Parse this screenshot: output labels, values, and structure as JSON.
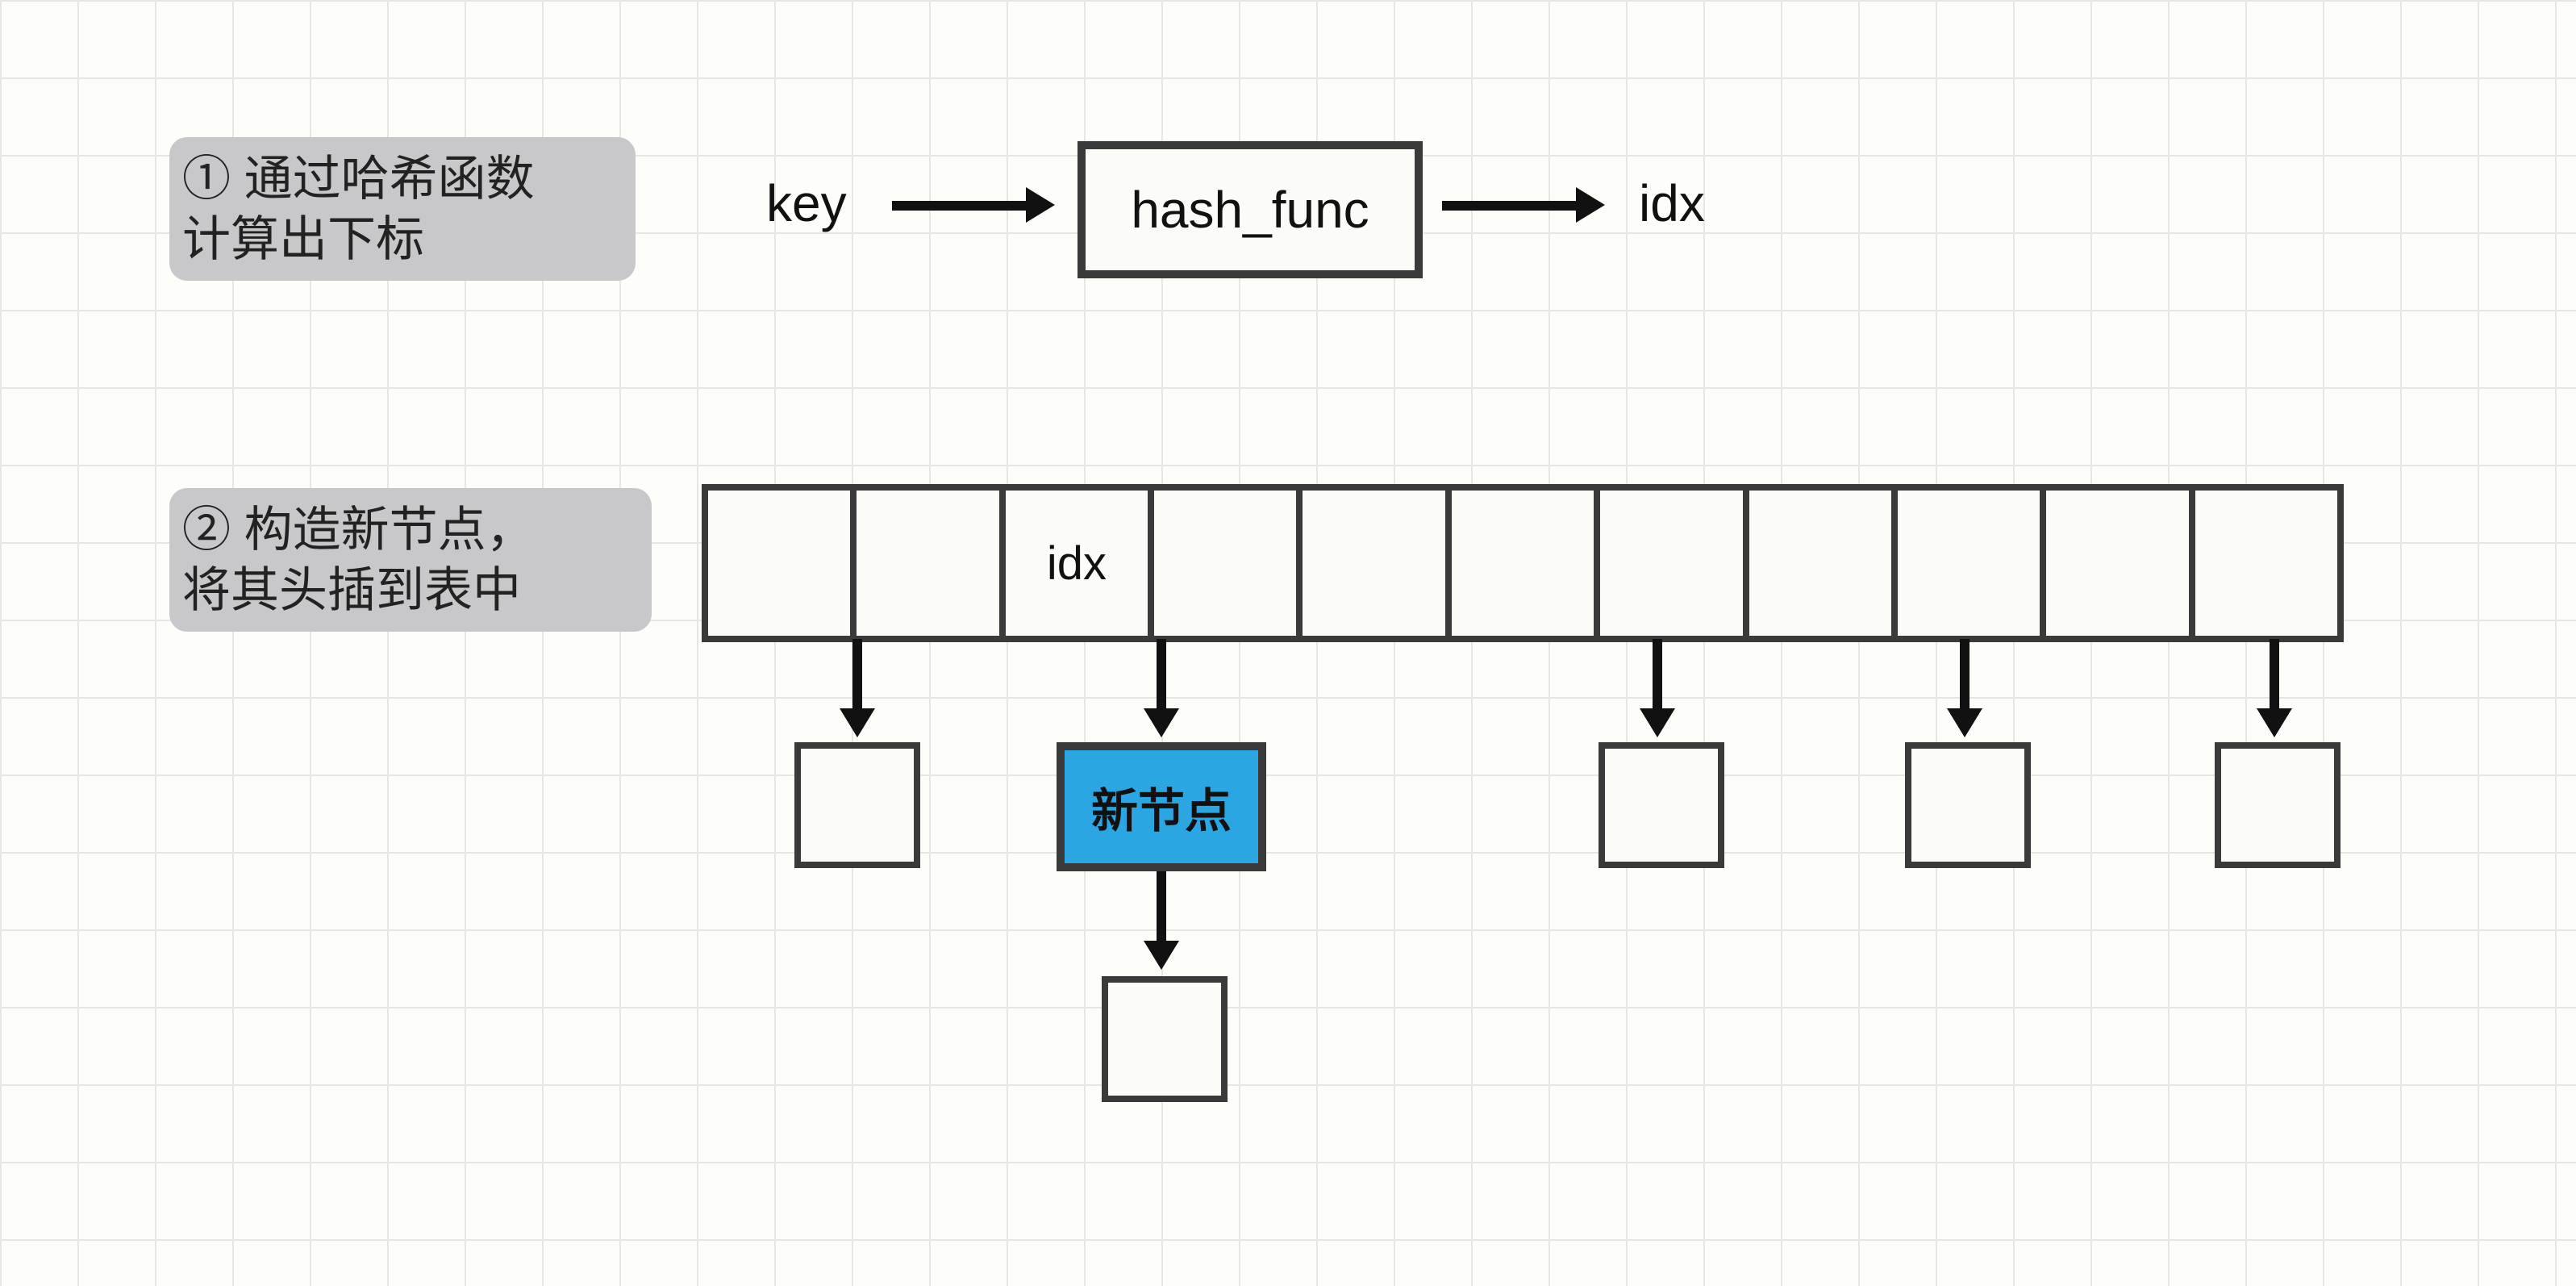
{
  "step1": {
    "label": "① 通过哈希函数\n计算出下标",
    "key_text": "key",
    "hash_func_text": "hash_func",
    "idx_text": "idx"
  },
  "step2": {
    "label": "② 构造新节点，\n将其头插到表中",
    "idx_slot_label": "idx",
    "new_node_label": "新节点"
  }
}
